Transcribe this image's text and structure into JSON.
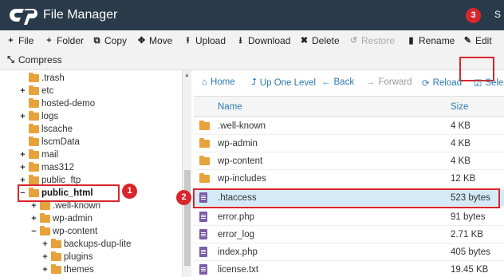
{
  "header": {
    "title": "File Manager",
    "user_cut": "S"
  },
  "toolbar": {
    "file": "File",
    "folder": "Folder",
    "copy": "Copy",
    "move": "Move",
    "upload": "Upload",
    "download": "Download",
    "delete": "Delete",
    "restore": "Restore",
    "rename": "Rename",
    "edit": "Edit",
    "compress": "Compress"
  },
  "tree": [
    {
      "label": ".trash",
      "toggle": ""
    },
    {
      "label": "etc",
      "toggle": "+"
    },
    {
      "label": "hosted-demo",
      "toggle": ""
    },
    {
      "label": "logs",
      "toggle": "+"
    },
    {
      "label": "lscache",
      "toggle": ""
    },
    {
      "label": "lscmData",
      "toggle": ""
    },
    {
      "label": "mail",
      "toggle": "+"
    },
    {
      "label": "mas312",
      "toggle": "+"
    },
    {
      "label": "public_ftp",
      "toggle": "+"
    },
    {
      "label": "public_html",
      "toggle": "−"
    },
    {
      "label": ".well-known",
      "toggle": "+"
    },
    {
      "label": "wp-admin",
      "toggle": "+"
    },
    {
      "label": "wp-content",
      "toggle": "−"
    },
    {
      "label": "backups-dup-lite",
      "toggle": "+"
    },
    {
      "label": "plugins",
      "toggle": "+"
    },
    {
      "label": "themes",
      "toggle": "+"
    }
  ],
  "nav": {
    "home": "Home",
    "up": "Up One Level",
    "back": "Back",
    "forward": "Forward",
    "reload": "Reload",
    "select": "Sele"
  },
  "list": {
    "col_name": "Name",
    "col_size": "Size",
    "rows": [
      {
        "name": ".well-known",
        "size": "4 KB",
        "type": "folder"
      },
      {
        "name": "wp-admin",
        "size": "4 KB",
        "type": "folder"
      },
      {
        "name": "wp-content",
        "size": "4 KB",
        "type": "folder"
      },
      {
        "name": "wp-includes",
        "size": "12 KB",
        "type": "folder"
      },
      {
        "name": ".htaccess",
        "size": "523 bytes",
        "type": "file"
      },
      {
        "name": "error.php",
        "size": "91 bytes",
        "type": "file"
      },
      {
        "name": "error_log",
        "size": "2.71 KB",
        "type": "file"
      },
      {
        "name": "index.php",
        "size": "405 bytes",
        "type": "file"
      },
      {
        "name": "license.txt",
        "size": "19.45 KB",
        "type": "file"
      }
    ]
  },
  "badges": {
    "b1": "1",
    "b2": "2",
    "b3": "3"
  },
  "colors": {
    "header_bg": "#293a4a",
    "accent": "#2a7ab0",
    "highlight_border": "#d9262c",
    "folder": "#e8a23a",
    "file_icon": "#7b5ca8",
    "selected_row": "#d4ebf7"
  }
}
